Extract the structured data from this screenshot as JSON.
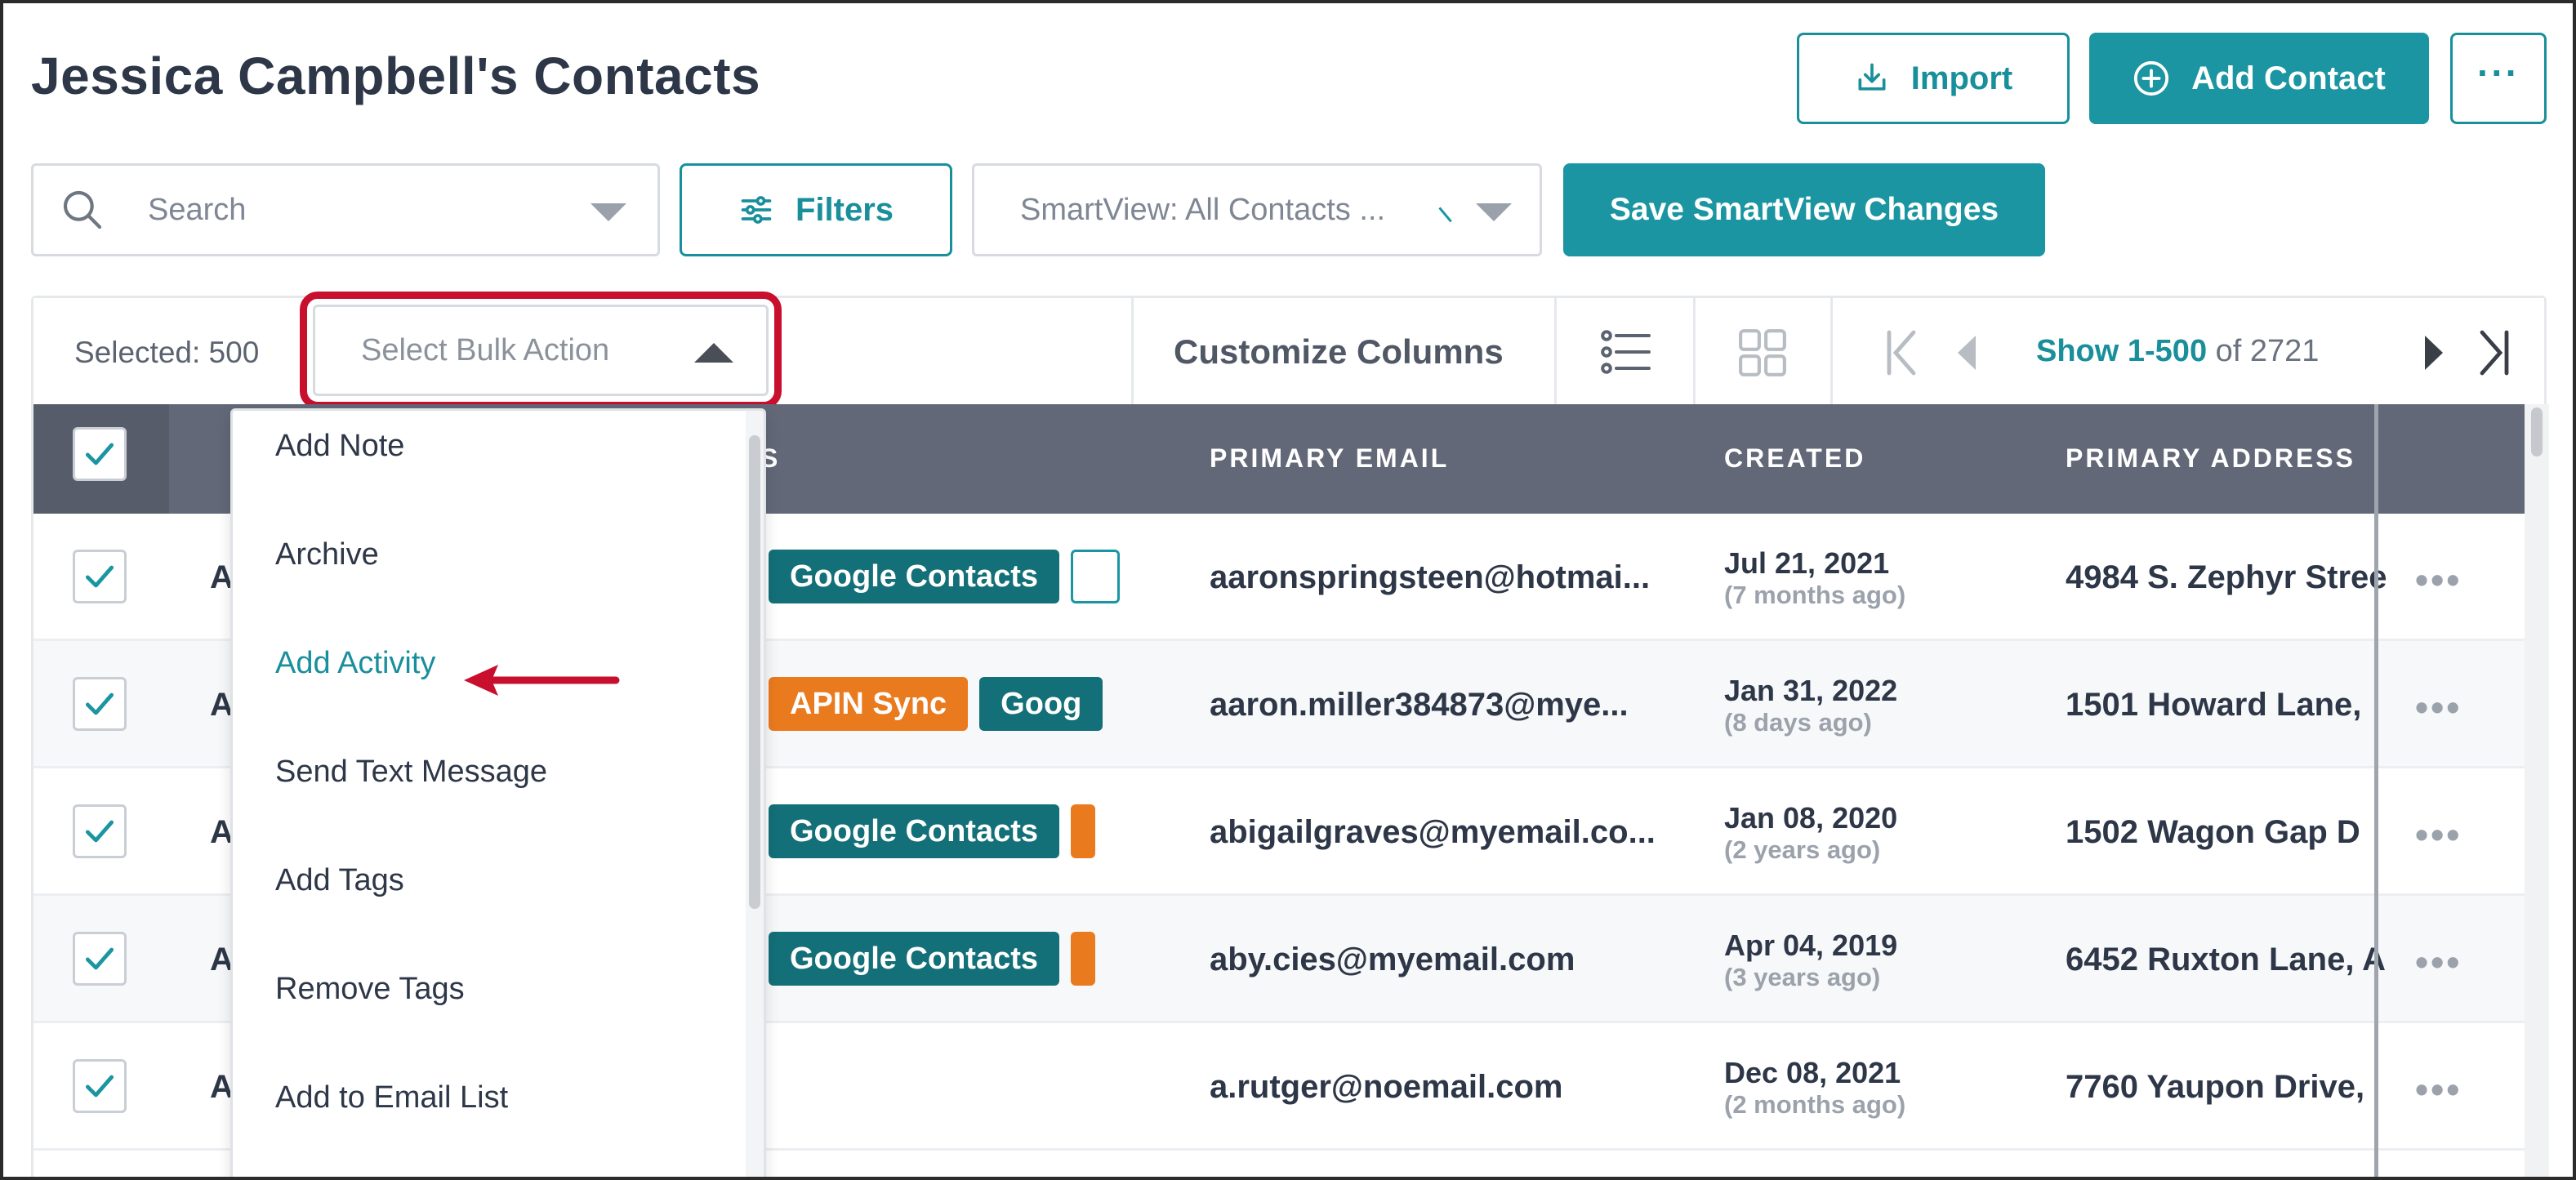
{
  "header": {
    "title": "Jessica Campbell's Contacts",
    "import_label": "Import",
    "add_contact_label": "Add Contact",
    "more_label": "···"
  },
  "filters_bar": {
    "search_placeholder": "Search",
    "filters_label": "Filters",
    "smartview_value": "SmartView: All Contacts ...",
    "save_smartview_label": "Save SmartView Changes"
  },
  "toolbar": {
    "selected_text": "Selected: 500",
    "bulk_action_placeholder": "Select Bulk Action",
    "customize_columns_label": "Customize Columns",
    "pager_range": "Show 1-500",
    "pager_total": "of 2721"
  },
  "table": {
    "columns": {
      "col_b_fragment": "S",
      "primary_email": "PRIMARY EMAIL",
      "created": "CREATED",
      "primary_address": "PRIMARY ADDRESS"
    },
    "rows": [
      {
        "initial": "A",
        "tags": [
          {
            "label": "",
            "style": "ghost"
          },
          {
            "label": "Google Contacts",
            "style": "teal"
          },
          {
            "label": "",
            "style": "ghost-end"
          }
        ],
        "email": "aaronspringsteen@hotmai...",
        "created": "Jul 21, 2021",
        "created_ago": "(7 months ago)",
        "address": "4984 S. Zephyr Stree"
      },
      {
        "initial": "A",
        "tags": [
          {
            "label": "",
            "style": "ghost"
          },
          {
            "label": "APIN Sync",
            "style": "orange"
          },
          {
            "label": "Goog",
            "style": "teal"
          }
        ],
        "email": "aaron.miller384873@mye...",
        "created": "Jan 31, 2022",
        "created_ago": "(8 days ago)",
        "address": "1501 Howard Lane,"
      },
      {
        "initial": "A",
        "tags": [
          {
            "label": "",
            "style": "ghost"
          },
          {
            "label": "Google Contacts",
            "style": "teal"
          },
          {
            "label": "",
            "style": "orange-end"
          }
        ],
        "email": "abigailgraves@myemail.co...",
        "created": "Jan 08, 2020",
        "created_ago": "(2 years ago)",
        "address": "1502 Wagon Gap D"
      },
      {
        "initial": "A",
        "tags": [
          {
            "label": "",
            "style": "ghost"
          },
          {
            "label": "Google Contacts",
            "style": "teal"
          },
          {
            "label": "",
            "style": "orange-end"
          }
        ],
        "email": "aby.cies@myemail.com",
        "created": "Apr 04, 2019",
        "created_ago": "(3 years ago)",
        "address": "6452 Ruxton Lane, A"
      },
      {
        "initial": "A",
        "tags": [],
        "email": "a.rutger@noemail.com",
        "created": "Dec 08, 2021",
        "created_ago": "(2 months ago)",
        "address": "7760 Yaupon Drive,"
      }
    ]
  },
  "bulk_menu": {
    "items": [
      {
        "label": "Add Note"
      },
      {
        "label": "Archive"
      },
      {
        "label": "Add Activity",
        "active": true
      },
      {
        "label": "Send Text Message"
      },
      {
        "label": "Add Tags"
      },
      {
        "label": "Remove Tags"
      },
      {
        "label": "Add to Email List"
      }
    ]
  },
  "colors": {
    "accent": "#1a95a1",
    "header_bg": "#626877",
    "highlight_red": "#c8102e",
    "tag_teal": "#136f78",
    "tag_orange": "#ea7a1e"
  },
  "icons": {
    "import": "download-tray-icon",
    "add_contact": "plus-circle-icon",
    "search": "magnifier-icon",
    "filters": "sliders-icon",
    "list_view": "list-icon",
    "grid_view": "grid-icon",
    "first_page": "first-page-icon",
    "prev_page": "prev-page-icon",
    "next_page": "next-page-icon",
    "last_page": "last-page-icon"
  }
}
